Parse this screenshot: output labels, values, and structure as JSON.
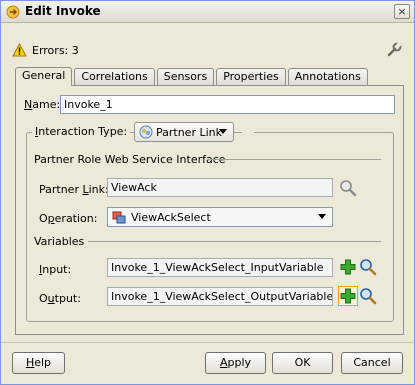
{
  "window": {
    "title": "Edit Invoke",
    "close_label": "×"
  },
  "errors": {
    "text": "Errors: 3"
  },
  "tabs": [
    {
      "label": "General"
    },
    {
      "label": "Correlations"
    },
    {
      "label": "Sensors"
    },
    {
      "label": "Properties"
    },
    {
      "label": "Annotations"
    }
  ],
  "general": {
    "name_label_u": "N",
    "name_label_rest": "ame:",
    "name_value": "Invoke_1",
    "interaction_label_u": "I",
    "interaction_label_rest": "nteraction Type:",
    "interaction_value": "Partner Link",
    "partner_section": "Partner Role Web Service Interface",
    "partner_link_label_pre": "Partner ",
    "partner_link_label_u": "L",
    "partner_link_label_rest": "ink:",
    "partner_link_value": "ViewAck",
    "operation_label_pre": "O",
    "operation_label_u": "p",
    "operation_label_rest": "eration:",
    "operation_value": "ViewAckSelect",
    "variables_section": "Variables",
    "input_label_u": "I",
    "input_label_rest": "nput:",
    "input_value": "Invoke_1_ViewAckSelect_InputVariable",
    "output_label_pre": "O",
    "output_label_u": "u",
    "output_label_rest": "tput:",
    "output_value": "Invoke_1_ViewAckSelect_OutputVariable"
  },
  "buttons": {
    "help_u": "H",
    "help_rest": "elp",
    "apply_u": "A",
    "apply_rest": "pply",
    "ok": "OK",
    "cancel": "Cancel"
  },
  "colors": {
    "accent_green": "#2e9e2a",
    "tab_active": "#ece9d8",
    "dialog_bg": "#ece9d8"
  }
}
